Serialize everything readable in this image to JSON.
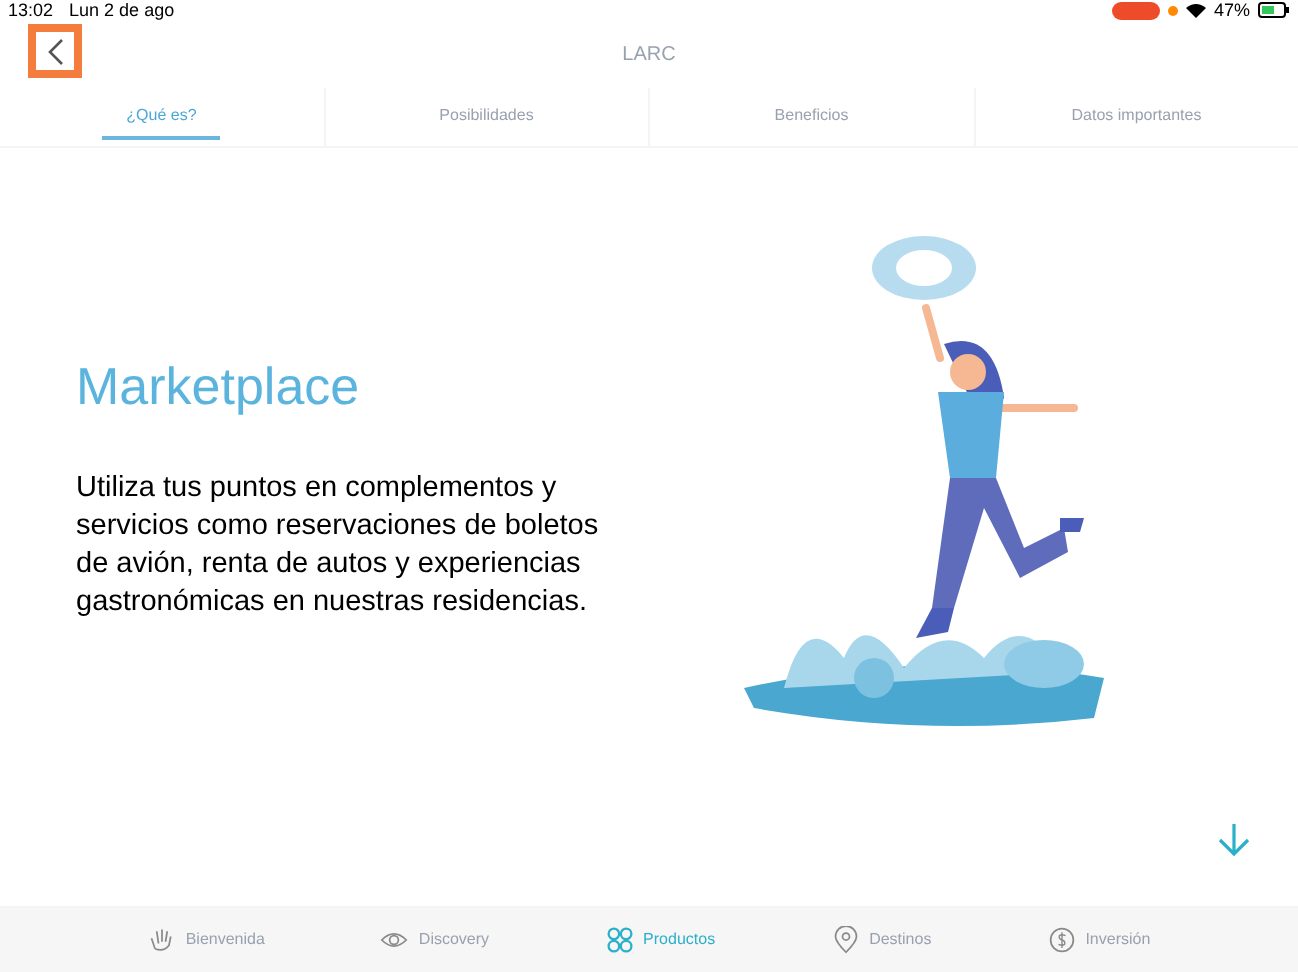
{
  "status_bar": {
    "time": "13:02",
    "date": "Lun 2 de ago",
    "battery": "47%",
    "recording": true
  },
  "header": {
    "title": "LARC",
    "back_highlighted": true
  },
  "tabs": [
    {
      "label": "¿Qué es?",
      "selected": true
    },
    {
      "label": "Posibilidades",
      "selected": false
    },
    {
      "label": "Beneficios",
      "selected": false
    },
    {
      "label": "Datos importantes",
      "selected": false
    }
  ],
  "content": {
    "heading": "Marketplace",
    "body": "Utiliza tus puntos en complementos y servicios como reservaciones de boletos de avión, renta de autos y experiencias gastronómicas en nuestras residencias."
  },
  "bottom_nav": [
    {
      "label": "Bienvenida",
      "kind": "hand",
      "selected": false
    },
    {
      "label": "Discovery",
      "kind": "eye",
      "selected": false
    },
    {
      "label": "Productos",
      "kind": "grid",
      "selected": true
    },
    {
      "label": "Destinos",
      "kind": "pin",
      "selected": false
    },
    {
      "label": "Inversión",
      "kind": "coin",
      "selected": false
    }
  ]
}
